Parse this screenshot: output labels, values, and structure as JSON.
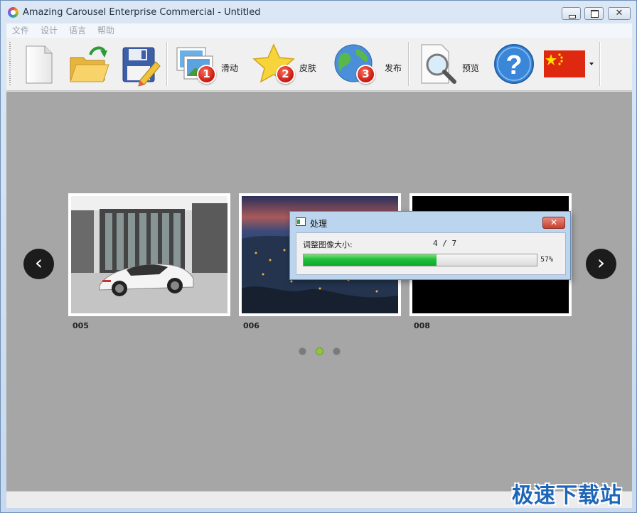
{
  "window": {
    "title": "Amazing Carousel Enterprise Commercial - Untitled",
    "close_glyph": "✕"
  },
  "menu": {
    "items": [
      "文件",
      "设计",
      "语言",
      "帮助"
    ]
  },
  "toolbar": {
    "buttons": [
      {
        "name": "new-file",
        "icon": "blank-page-icon",
        "label": ""
      },
      {
        "name": "open-file",
        "icon": "open-folder-icon",
        "label": ""
      },
      {
        "name": "save-file",
        "icon": "floppy-pencil-icon",
        "label": ""
      },
      {
        "name": "slides",
        "icon": "pictures-icon",
        "badge": "1",
        "label": "滑动"
      },
      {
        "name": "skin",
        "icon": "star-icon",
        "badge": "2",
        "label": "皮肤"
      },
      {
        "name": "publish",
        "icon": "globe-icon",
        "badge": "3",
        "label": "发布"
      },
      {
        "name": "preview",
        "icon": "magnifier-icon",
        "label": "预览"
      },
      {
        "name": "help",
        "icon": "question-icon",
        "label": ""
      },
      {
        "name": "language",
        "icon": "china-flag-icon",
        "label": ""
      }
    ]
  },
  "carousel": {
    "items": [
      {
        "label": "005"
      },
      {
        "label": "006"
      },
      {
        "label": "008"
      }
    ],
    "prev_glyph": "‹",
    "next_glyph": "›",
    "dots": 3,
    "active_dot": 1
  },
  "dialog": {
    "title": "处理",
    "close_glyph": "✕",
    "task_label": "调整图像大小:",
    "count": "4 / 7",
    "progress_fraction": 0.57,
    "progress_text": "57%"
  },
  "watermark": "极速下载站",
  "colors": {
    "accent": "#1ebe3a",
    "content_bg": "#a6a6a6",
    "dot_active": "#8dc63f",
    "watermark": "#1e66b8"
  }
}
